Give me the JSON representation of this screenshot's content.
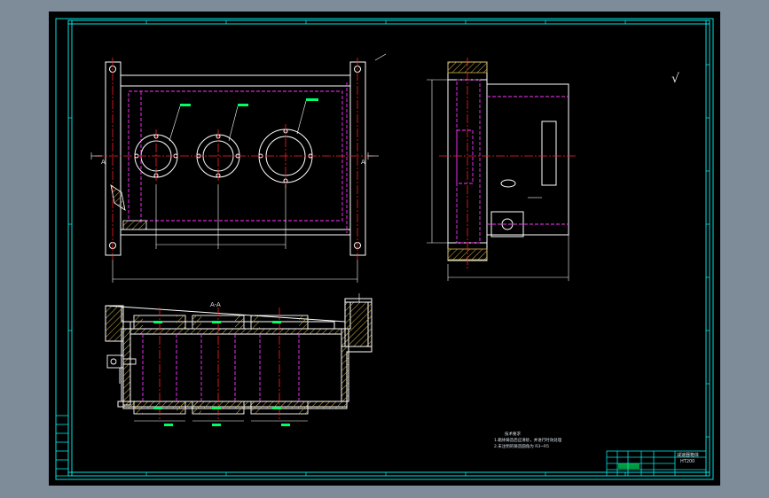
{
  "drawing": {
    "section_label": "A-A",
    "cut_label_left": "A",
    "cut_label_right": "A",
    "roughness_mark": "√",
    "tech_requirements": {
      "title": "技术要求",
      "lines": [
        "1.箱体铸造后应清砂，并进行时效处理",
        "2.未注明的铸造圆角为 R3~R5"
      ]
    },
    "title_block": {
      "name": "减速器箱体",
      "material": "HT200"
    }
  },
  "colors": {
    "viewport": "#000000",
    "frame": "#00e5e5",
    "outline": "#ffffff",
    "center": "#ff2020",
    "hidden": "#ff33ff",
    "annotation": "#00ff66",
    "hatch": "#d4b448"
  }
}
